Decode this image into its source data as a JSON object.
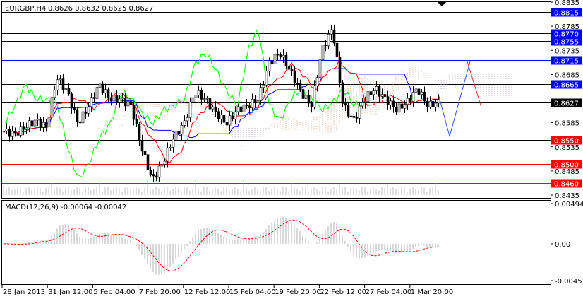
{
  "chart_data": {
    "type": "candlestick",
    "title": "EURGBP,H4",
    "ohlc_label": "0.8626 0.8632 0.8625 0.8627",
    "current_price": 0.8627,
    "y_range": [
      0.8435,
      0.8835
    ],
    "price_ticks": [
      "0.8835",
      "0.8785",
      "0.8735",
      "0.8685",
      "0.8585",
      "0.8535",
      "0.8485",
      "0.8435"
    ],
    "levels": [
      {
        "value": 0.8815,
        "label": "0.8815",
        "color": "#0000ff",
        "line": "#000000"
      },
      {
        "value": 0.877,
        "label": "0.8770",
        "color": "#0000ff",
        "line": "#000000"
      },
      {
        "value": 0.8755,
        "label": "0.8755",
        "color": "#0000ff",
        "line": "#000000"
      },
      {
        "value": 0.8715,
        "label": "0.8715",
        "color": "#0000ff",
        "line": "#0000ff"
      },
      {
        "value": 0.8665,
        "label": "0.8665",
        "color": "#0000ff",
        "line": "#000000"
      },
      {
        "value": 0.8627,
        "label": "0.8627",
        "color": "#000000",
        "line": "#000000"
      },
      {
        "value": 0.855,
        "label": "0.8550",
        "color": "#ff0000",
        "line": "#000000"
      },
      {
        "value": 0.85,
        "label": "0.8500",
        "color": "#ff0000",
        "line": "#ff0000"
      },
      {
        "value": 0.846,
        "label": "0.8460",
        "color": "#ff0000",
        "line": "#ff0000"
      }
    ],
    "key_closes": [
      0.8568,
      0.8561,
      0.8576,
      0.859,
      0.8576,
      0.8678,
      0.8649,
      0.8583,
      0.862,
      0.8664,
      0.8634,
      0.8634,
      0.862,
      0.8532,
      0.8466,
      0.8502,
      0.8554,
      0.8583,
      0.8649,
      0.8634,
      0.8605,
      0.8583,
      0.8612,
      0.862,
      0.8634,
      0.8708,
      0.873,
      0.8693,
      0.8649,
      0.862,
      0.8737,
      0.8781,
      0.862,
      0.859,
      0.8634,
      0.8656,
      0.8634,
      0.8612,
      0.8627,
      0.8656,
      0.862,
      0.8627
    ],
    "bars": 155,
    "x_labels": [
      "28 Jan 2013",
      "31 Jan 12:00",
      "5 Feb 04:00",
      "7 Feb 20:00",
      "12 Feb 12:00",
      "15 Feb 04:00",
      "19 Feb 20:00",
      "22 Feb 12:00",
      "27 Feb 04:00",
      "1 Mar 20:00"
    ],
    "macd": {
      "label": "MACD(12,26,9) -0.00064 -0.00042",
      "ticks": [
        "0.00494",
        "0.00",
        "-0.00452"
      ],
      "range": [
        -0.00452,
        0.00494
      ]
    }
  }
}
